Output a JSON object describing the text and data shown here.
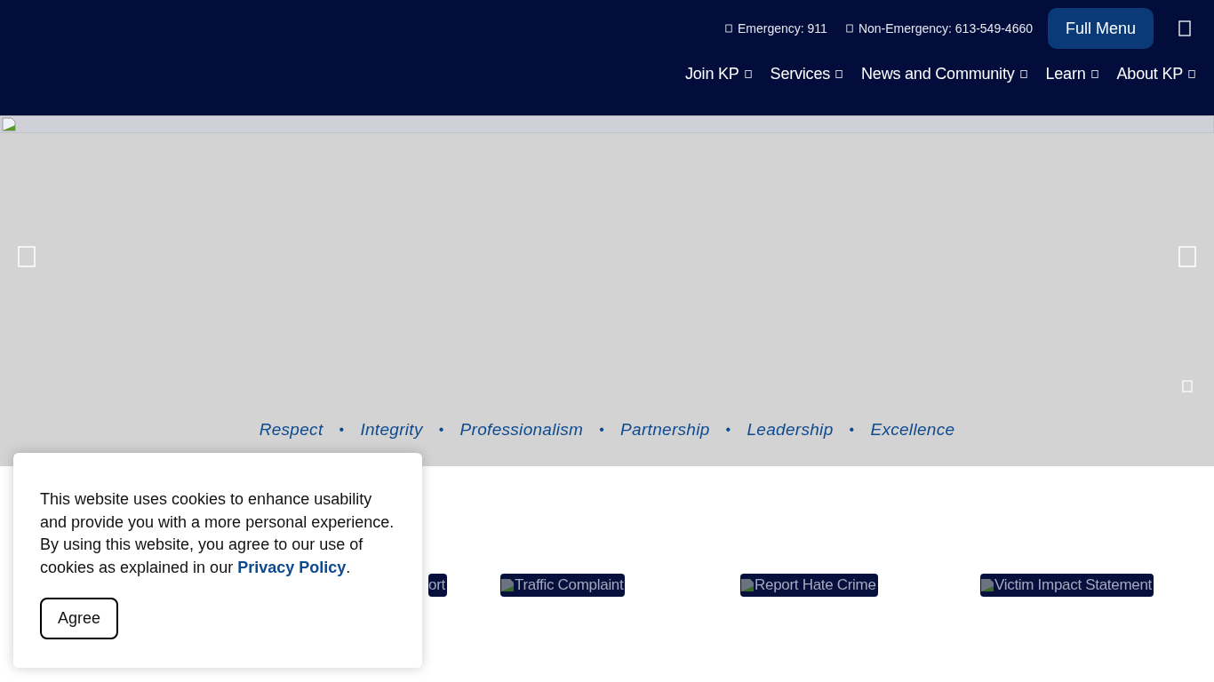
{
  "header": {
    "contacts": [
      {
        "label": "Emergency: 911"
      },
      {
        "label": "Non-Emergency: 613-549-4660"
      }
    ],
    "full_menu_button": "Full Menu",
    "nav": [
      {
        "label": "Join KP"
      },
      {
        "label": "Services"
      },
      {
        "label": "News and Community"
      },
      {
        "label": "Learn"
      },
      {
        "label": "About KP"
      }
    ]
  },
  "hero": {
    "values": [
      {
        "kind": "value",
        "text": "Respect"
      },
      {
        "kind": "separator",
        "text": "•"
      },
      {
        "kind": "value",
        "text": "Integrity"
      },
      {
        "kind": "separator",
        "text": "•"
      },
      {
        "kind": "value",
        "text": "Professionalism"
      },
      {
        "kind": "separator",
        "text": "•"
      },
      {
        "kind": "value",
        "text": "Partnership"
      },
      {
        "kind": "separator",
        "text": "•"
      },
      {
        "kind": "value",
        "text": "Leadership"
      },
      {
        "kind": "separator",
        "text": "•"
      },
      {
        "kind": "value",
        "text": "Excellence"
      }
    ]
  },
  "quick_links": [
    {
      "label": "ort"
    },
    {
      "label": "Traffic Complaint"
    },
    {
      "label": "Report Hate Crime"
    },
    {
      "label": "Victim Impact Statement"
    }
  ],
  "cookie_notice": {
    "text": "This website uses cookies to enhance usability and provide you with a more personal experience. By using this website, you agree to our use of cookies as explained in our ",
    "link": "Privacy Policy",
    "text_after": ".",
    "button": "Agree"
  }
}
